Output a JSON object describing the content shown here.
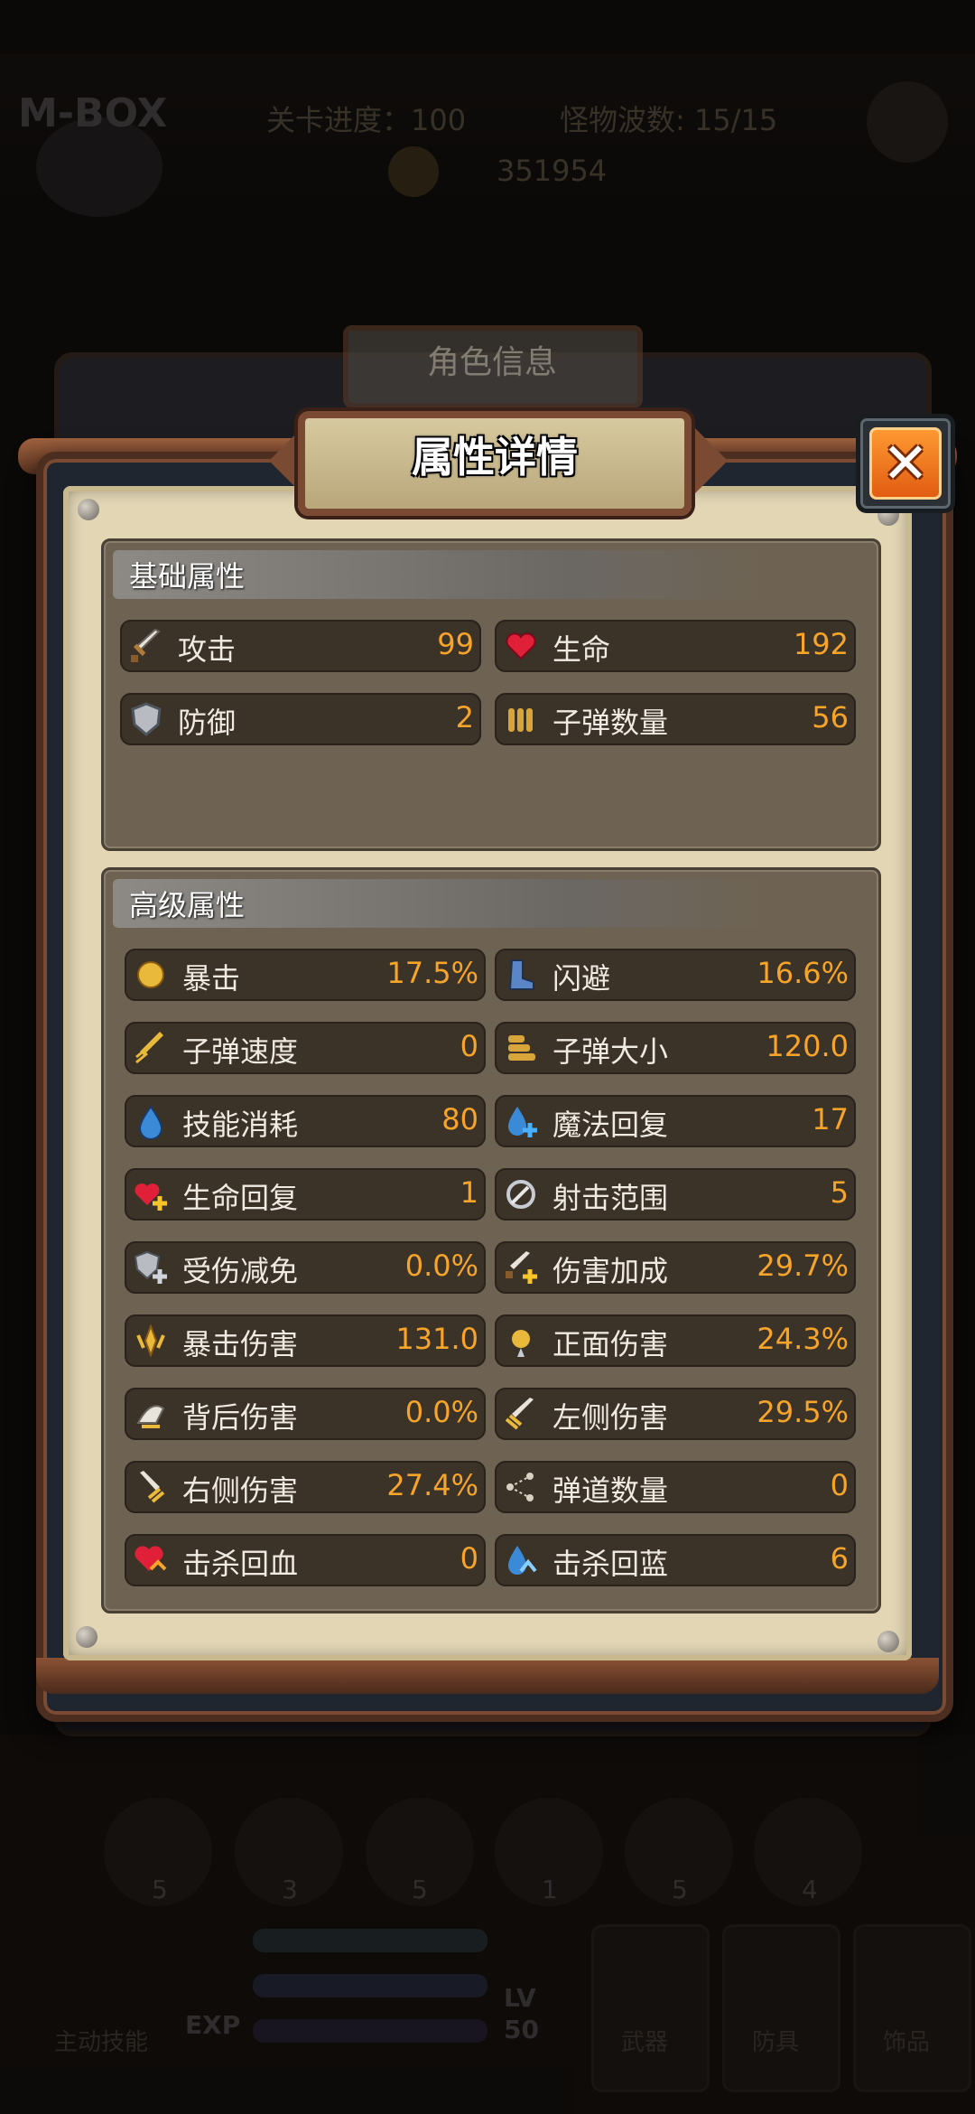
{
  "background": {
    "logo": "M-BOX",
    "level_progress": "关卡进度：100",
    "monster_waves": "怪物波数: 15/15",
    "gold": "351954",
    "slot_counts": [
      "5",
      "3",
      "5",
      "1",
      "5",
      "4"
    ],
    "exp_label": "EXP",
    "lv_label": "LV",
    "lv_value": "50",
    "auto_label": "主动技能",
    "card_labels": [
      "武器",
      "防具",
      "饰品"
    ]
  },
  "back_panel": {
    "title": "角色信息"
  },
  "modal": {
    "title": "属性详情",
    "close_label": "✕"
  },
  "basic": {
    "label": "基础属性",
    "stats": [
      {
        "name": "攻击",
        "value": "99",
        "icon": "sword-icon"
      },
      {
        "name": "生命",
        "value": "192",
        "icon": "heart-icon"
      },
      {
        "name": "防御",
        "value": "2",
        "icon": "shield-icon"
      },
      {
        "name": "子弹数量",
        "value": "56",
        "icon": "bullets-icon"
      }
    ]
  },
  "advanced": {
    "label": "高级属性",
    "stats": [
      {
        "name": "暴击",
        "value": "17.5%",
        "icon": "fist-icon"
      },
      {
        "name": "闪避",
        "value": "16.6%",
        "icon": "boot-icon"
      },
      {
        "name": "子弹速度",
        "value": "0",
        "icon": "bullet-speed-icon"
      },
      {
        "name": "子弹大小",
        "value": "120.0",
        "icon": "bullet-size-icon"
      },
      {
        "name": "技能消耗",
        "value": "80",
        "icon": "mana-drop-icon"
      },
      {
        "name": "魔法回复",
        "value": "17",
        "icon": "mana-plus-icon"
      },
      {
        "name": "生命回复",
        "value": "1",
        "icon": "heart-plus-icon"
      },
      {
        "name": "射击范围",
        "value": "5",
        "icon": "range-icon"
      },
      {
        "name": "受伤减免",
        "value": "0.0%",
        "icon": "shield-plus-icon"
      },
      {
        "name": "伤害加成",
        "value": "29.7%",
        "icon": "sword-plus-icon"
      },
      {
        "name": "暴击伤害",
        "value": "131.0",
        "icon": "crit-damage-icon"
      },
      {
        "name": "正面伤害",
        "value": "24.3%",
        "icon": "front-damage-icon"
      },
      {
        "name": "背后伤害",
        "value": "0.0%",
        "icon": "back-damage-icon"
      },
      {
        "name": "左侧伤害",
        "value": "29.5%",
        "icon": "left-damage-icon"
      },
      {
        "name": "右侧伤害",
        "value": "27.4%",
        "icon": "right-damage-icon"
      },
      {
        "name": "弹道数量",
        "value": "0",
        "icon": "trajectory-icon"
      },
      {
        "name": "击杀回血",
        "value": "0",
        "icon": "kill-heal-icon"
      },
      {
        "name": "击杀回蓝",
        "value": "6",
        "icon": "kill-mana-icon"
      }
    ]
  },
  "colors": {
    "value": "#f7a42a",
    "close": "#f07a1e",
    "parchment": "#e2d6b5",
    "section": "#6e6353"
  }
}
